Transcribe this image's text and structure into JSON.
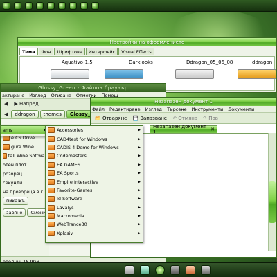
{
  "appearance": {
    "title": "Настройки на оформлението",
    "tabs": [
      "Тема",
      "Фон",
      "Шрифтове",
      "Интерфейс",
      "Visual Effects"
    ],
    "themes": [
      "Aquativo-1.5",
      "Darklooks",
      "Ddragon_05_06_08",
      "ddragon"
    ]
  },
  "nautilus": {
    "title": "Glossy_Green - Файлов браузър",
    "menus": [
      "актиране",
      "Изглед",
      "Отиване",
      "Отметки",
      "Помощ"
    ],
    "forward": "Напред",
    "crumbs": [
      "ddragon",
      "themes",
      "Glossy_Gr"
    ],
    "sidebar": [
      "ams",
      "e CS Drive",
      "gure Wine",
      "tall Wine Software",
      "отен плот",
      "розорец",
      "секунди",
      "на прозореца в г",
      "пикажъ"
    ],
    "buttons": [
      "завяне",
      "Смени"
    ],
    "status": "ободни: 18,9GB"
  },
  "gedit": {
    "title": "Незапазен документ 1",
    "menus": [
      "Файл",
      "Редактиране",
      "Изглед",
      "Търсене",
      "Инструменти",
      "Документи"
    ],
    "toolbar": {
      "revert": "Отваряне",
      "save": "Запазване",
      "undo": "Отмяна",
      "redo": "Пов"
    },
    "doc_tab": "Незапазен документ 1"
  },
  "menu1": {
    "item": "ams"
  },
  "menu2": {
    "items": [
      "Accessories",
      "CAD4test for Windows",
      "CADIS 4 Demo for Windows",
      "Codemasters",
      "EA GAMES",
      "EA Sports",
      "Empire Interactive",
      "Favorite-Games",
      "Id Software",
      "Lavalys",
      "Macromedia",
      "WebTrance30",
      "Xplosiv"
    ]
  },
  "colors": {
    "glass_green": "#7fd147",
    "dark_green": "#16300f",
    "folder_orange": "#e07b1a"
  }
}
